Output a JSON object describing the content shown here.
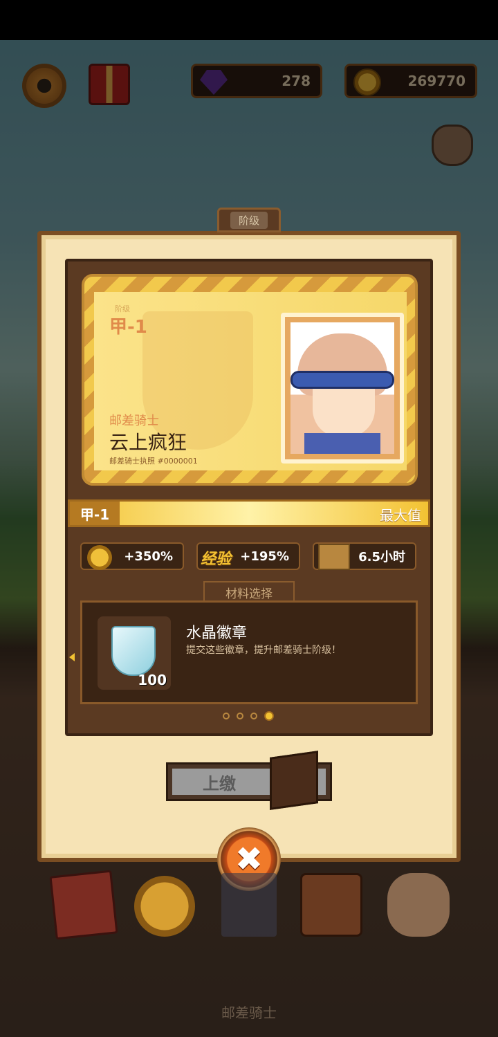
{
  "hud": {
    "gems": "278",
    "coins": "269770"
  },
  "panel": {
    "tab_label": "阶级"
  },
  "card": {
    "rank_caption": "阶级",
    "rank": "甲-1",
    "job_title": "邮差骑士",
    "player_name": "云上疯狂",
    "license": "邮差骑士执照 #0000001"
  },
  "progress": {
    "level": "甲-1",
    "status": "最大值",
    "fill_fraction": 1.0
  },
  "stats": {
    "coin_bonus": "+350%",
    "exp_label": "经验",
    "exp_bonus": "+195%",
    "time": "6.5小时"
  },
  "material": {
    "tab_label": "材料选择",
    "name": "水晶徽章",
    "description": "提交这些徽章，提升邮差骑士阶级！",
    "count": "100"
  },
  "pagination": {
    "total": 4,
    "active_index": 4
  },
  "actions": {
    "submit_label": "上缴",
    "close_label": "✖"
  },
  "bottom_nav": {
    "active_label": "邮差骑士"
  },
  "colors": {
    "panel_bg": "#f6e3b5",
    "frame_brown": "#5b3a22",
    "accent_gold": "#f2c233",
    "close_orange": "#f07a2a"
  }
}
